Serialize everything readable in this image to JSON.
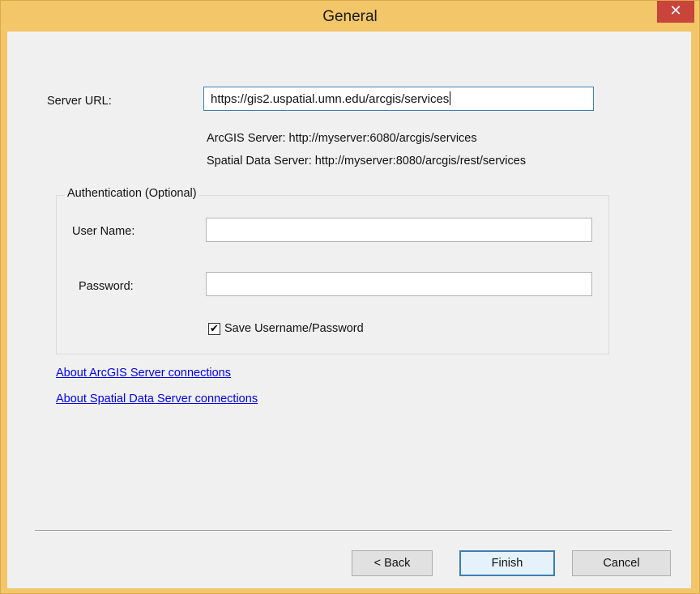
{
  "window": {
    "title": "General",
    "close_glyph": "✕"
  },
  "server": {
    "label": "Server URL:",
    "url_value": "https://gis2.uspatial.umn.edu/arcgis/services",
    "hint_arcgis": "ArcGIS Server: http://myserver:6080/arcgis/services",
    "hint_sds": "Spatial Data Server: http://myserver:8080/arcgis/rest/services"
  },
  "auth": {
    "group_title": "Authentication (Optional)",
    "username_label": "User Name:",
    "username_value": "",
    "password_label": "Password:",
    "password_value": "",
    "save_label": "Save Username/Password",
    "save_checked": true,
    "check_glyph": "✔"
  },
  "links": {
    "arcgis": "About ArcGIS Server connections",
    "sds": "About Spatial Data Server connections"
  },
  "buttons": {
    "back": "< Back",
    "finish": "Finish",
    "cancel": "Cancel"
  }
}
